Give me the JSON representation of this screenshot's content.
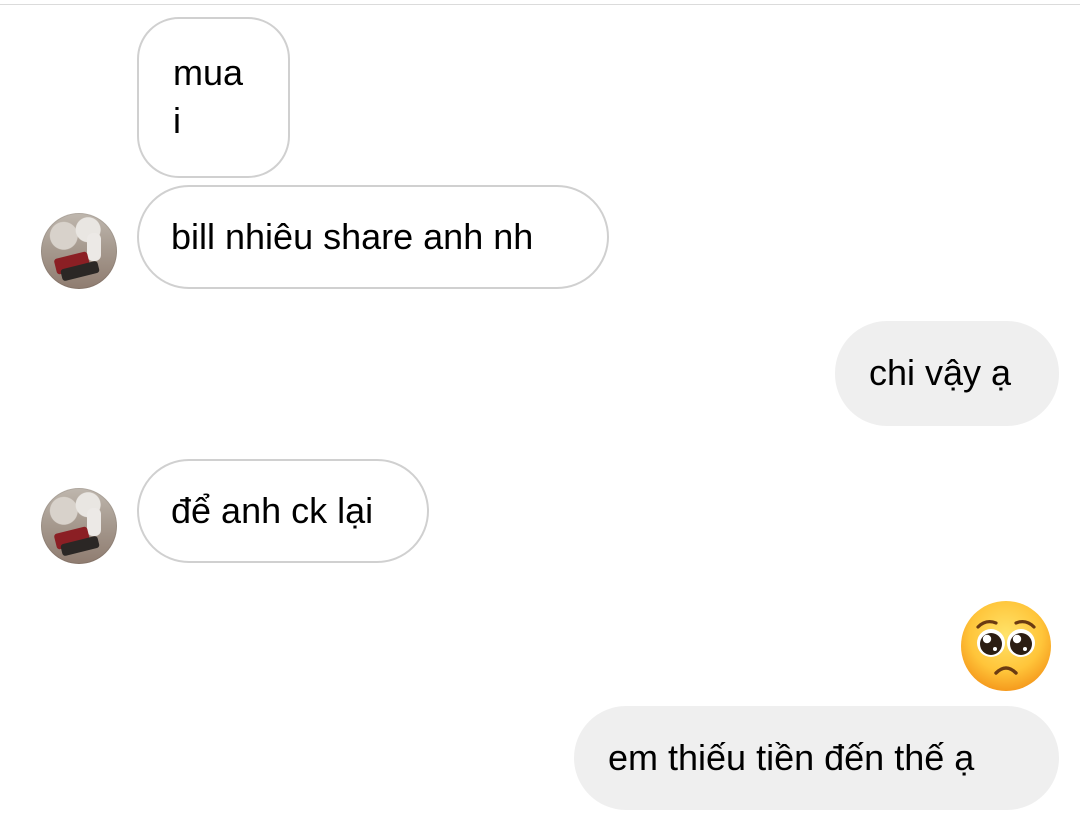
{
  "conversation": {
    "messages": [
      {
        "direction": "received",
        "lines": [
          "mua",
          "i"
        ],
        "has_avatar": false
      },
      {
        "direction": "received",
        "lines": [
          "bill nhiêu share anh nh"
        ],
        "has_avatar": true
      },
      {
        "direction": "sent",
        "lines": [
          "chi vậy ạ"
        ]
      },
      {
        "direction": "received",
        "lines": [
          "để anh ck lại"
        ],
        "has_avatar": true
      },
      {
        "direction": "sent",
        "emoji": "pleading-face"
      },
      {
        "direction": "sent",
        "lines": [
          "em thiếu tiền đến thế ạ"
        ]
      }
    ]
  },
  "colors": {
    "received_bubble_bg": "#ffffff",
    "received_bubble_border": "#d0d0d0",
    "sent_bubble_bg": "#efefef",
    "text": "#000000"
  }
}
